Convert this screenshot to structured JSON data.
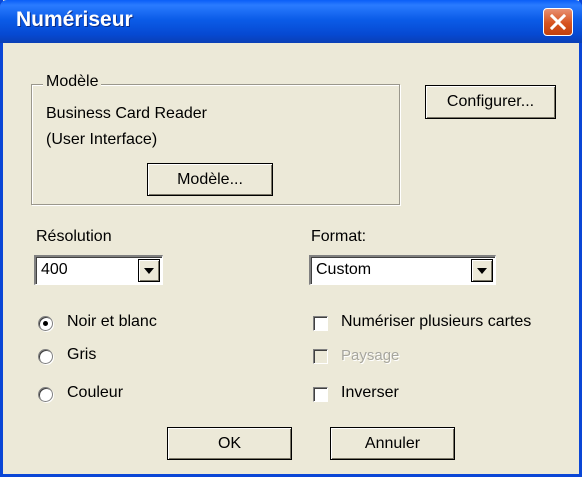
{
  "window": {
    "title": "Numériseur",
    "close_icon": "close-icon"
  },
  "model_group": {
    "legend": "Modèle",
    "name_line1": "Business Card Reader",
    "name_line2": "(User Interface)",
    "model_button": "Modèle..."
  },
  "configure_button": "Configurer...",
  "resolution": {
    "label": "Résolution",
    "value": "400"
  },
  "format": {
    "label": "Format:",
    "value": "Custom"
  },
  "color_mode": {
    "options": [
      {
        "label": "Noir et blanc",
        "selected": true
      },
      {
        "label": "Gris",
        "selected": false
      },
      {
        "label": "Couleur",
        "selected": false
      }
    ]
  },
  "options": {
    "multi_cards": {
      "label": "Numériser plusieurs cartes",
      "checked": false,
      "enabled": true
    },
    "landscape": {
      "label": "Paysage",
      "checked": false,
      "enabled": false
    },
    "invert": {
      "label": "Inverser",
      "checked": false,
      "enabled": true
    }
  },
  "buttons": {
    "ok": "OK",
    "cancel": "Annuler"
  },
  "colors": {
    "titlebar": "#0a5ce8",
    "dialog_face": "#ece9d8",
    "close_button": "#d7531f"
  }
}
